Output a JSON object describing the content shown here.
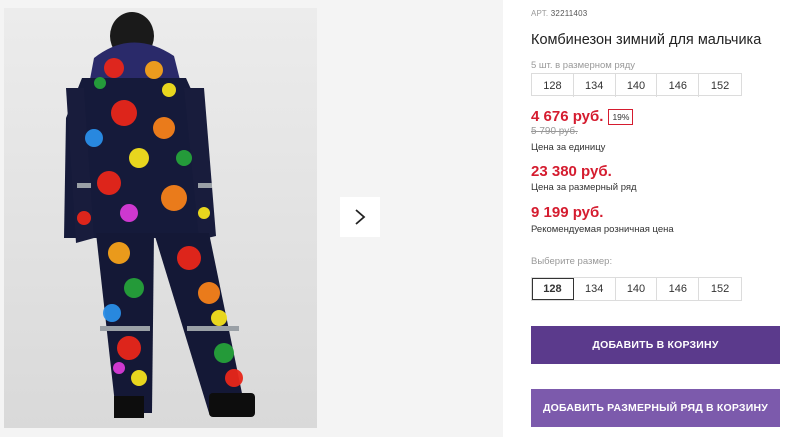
{
  "product": {
    "article_label": "АРТ.",
    "article_number": "32211403",
    "title": "Комбинезон зимний для мальчика"
  },
  "pack": {
    "label": "5 шт. в размерном ряду",
    "sizes": [
      "128",
      "134",
      "140",
      "146",
      "152"
    ]
  },
  "prices": {
    "current": "4 676 руб.",
    "discount": "19%",
    "old": "5 790 руб.",
    "unit_label": "Цена за единицу",
    "pack_price": "23 380 руб.",
    "pack_label": "Цена за размерный ряд",
    "retail_price": "9 199 руб.",
    "retail_label": "Рекомендуемая розничная цена"
  },
  "size_picker": {
    "label": "Выберите размер:",
    "sizes": [
      "128",
      "134",
      "140",
      "146",
      "152"
    ],
    "selected": "128"
  },
  "buttons": {
    "add_to_cart": "ДОБАВИТЬ В КОРЗИНУ",
    "add_pack_to_cart": "ДОБАВИТЬ РАЗМЕРНЫЙ РЯД В КОРЗИНУ"
  },
  "colors": {
    "price": "#d51c2f",
    "button_primary": "#5b3a8c",
    "button_secondary": "#7c5aac"
  },
  "icons": {
    "gallery_next": "chevron-right-icon"
  }
}
